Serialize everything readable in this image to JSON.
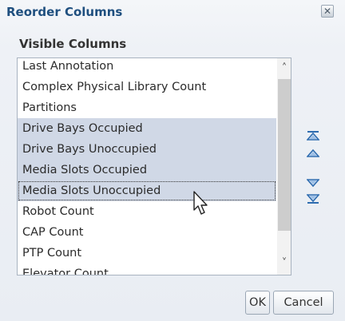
{
  "dialog": {
    "title": "Reorder Columns",
    "close_icon": "close-icon",
    "section_label": "Visible Columns"
  },
  "columns": [
    {
      "label": "Last Annotation",
      "selected": false
    },
    {
      "label": "Complex Physical Library Count",
      "selected": false
    },
    {
      "label": "Partitions",
      "selected": false
    },
    {
      "label": "Drive Bays Occupied",
      "selected": true
    },
    {
      "label": "Drive Bays Unoccupied",
      "selected": true
    },
    {
      "label": "Media Slots Occupied",
      "selected": true
    },
    {
      "label": "Media Slots Unoccupied",
      "selected": true,
      "focused": true
    },
    {
      "label": "Robot Count",
      "selected": false
    },
    {
      "label": "CAP Count",
      "selected": false
    },
    {
      "label": "PTP Count",
      "selected": false
    },
    {
      "label": "Elevator Count",
      "selected": false
    }
  ],
  "move_buttons": [
    {
      "icon": "move-to-top-icon"
    },
    {
      "icon": "move-up-icon"
    },
    {
      "icon": "move-down-icon"
    },
    {
      "icon": "move-to-bottom-icon"
    }
  ],
  "buttons": {
    "ok": "OK",
    "cancel": "Cancel"
  },
  "colors": {
    "title": "#1f4f7f",
    "selection": "#d0d8e6",
    "arrow": "#2f6db0"
  }
}
